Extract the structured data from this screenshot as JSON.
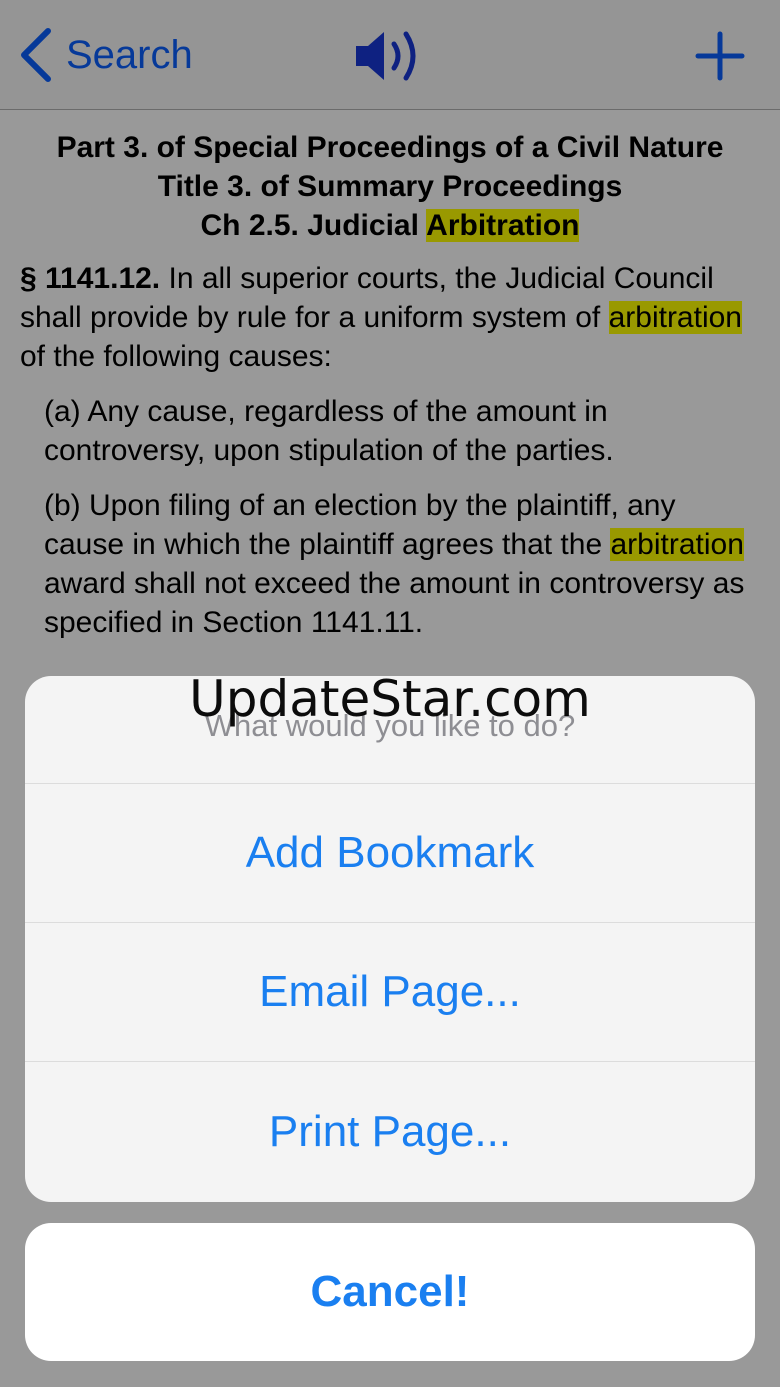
{
  "navbar": {
    "back_label": "Search",
    "back_icon": "chevron-left-icon",
    "sound_icon": "speaker-icon",
    "add_icon": "plus-icon",
    "accent_color": "#0a60ff"
  },
  "document": {
    "heading_lines": [
      "Part 3. of Special Proceedings of a Civil Nature",
      "Title 3. of Summary Proceedings"
    ],
    "chapter_prefix": "Ch 2.5. Judicial ",
    "chapter_highlight": "Arbitration",
    "section_number": "§ 1141.12.",
    "section_text_before": " In all superior courts, the Judicial Council shall provide by rule for a uniform system of ",
    "section_highlight": "arbitration",
    "section_text_after": " of the following causes:",
    "sub_a": "(a) Any cause, regardless of the amount in controversy, upon stipulation of the parties.",
    "sub_b_before": "(b) Upon filing of an election by the plaintiff, any cause in which the plaintiff agrees that the ",
    "sub_b_highlight": "arbitration",
    "sub_b_after": " award shall not exceed the amount in controversy as specified in Section 1141.11.",
    "highlight_color": "#ffff00"
  },
  "action_sheet": {
    "watermark": "UpdateStar.com",
    "title": "What would you like to do?",
    "buttons": [
      "Add Bookmark",
      "Email Page...",
      "Print Page..."
    ],
    "cancel_label": "Cancel!",
    "button_color": "#1a7ff0"
  }
}
